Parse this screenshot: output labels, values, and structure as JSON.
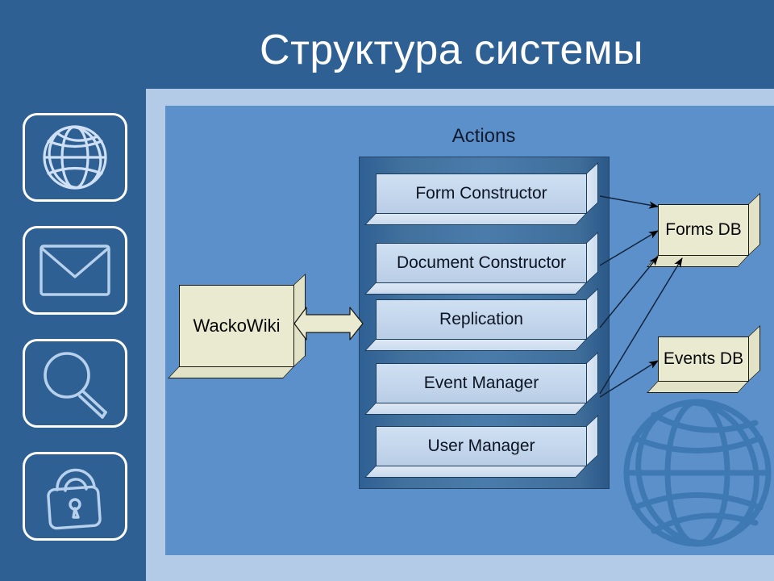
{
  "slide": {
    "title": "Структура системы",
    "background_color": "#2f6094",
    "frame_color": "#b3cbe6",
    "panel_color": "#5b90cb"
  },
  "icon_rail": {
    "items": [
      {
        "icon": "globe-icon",
        "label": "Globe"
      },
      {
        "icon": "envelope-icon",
        "label": "Envelope"
      },
      {
        "icon": "magnifier-icon",
        "label": "Magnifier"
      },
      {
        "icon": "padlock-icon",
        "label": "Padlock"
      }
    ]
  },
  "diagram": {
    "group_label": "Actions",
    "group_color": "#41719c",
    "actions": [
      {
        "label": "Form Constructor"
      },
      {
        "label": "Document Constructor"
      },
      {
        "label": "Replication"
      },
      {
        "label": "Event Manager"
      },
      {
        "label": "User Manager"
      }
    ],
    "client": {
      "label": "WackoWiki",
      "color": "#eaead0"
    },
    "databases": [
      {
        "label": "Forms DB",
        "color": "#eaead0"
      },
      {
        "label": "Events DB",
        "color": "#eaead0"
      }
    ],
    "connections": [
      {
        "from": "Form Constructor",
        "to": "Forms DB"
      },
      {
        "from": "Document Constructor",
        "to": "Forms DB"
      },
      {
        "from": "Replication",
        "to": "Forms DB"
      },
      {
        "from": "Event Manager",
        "to": "Forms DB"
      },
      {
        "from": "Event Manager",
        "to": "Events DB"
      },
      {
        "from": "WackoWiki",
        "to": "Actions",
        "style": "double-block-arrow"
      }
    ],
    "watermark": "globe-icon"
  }
}
